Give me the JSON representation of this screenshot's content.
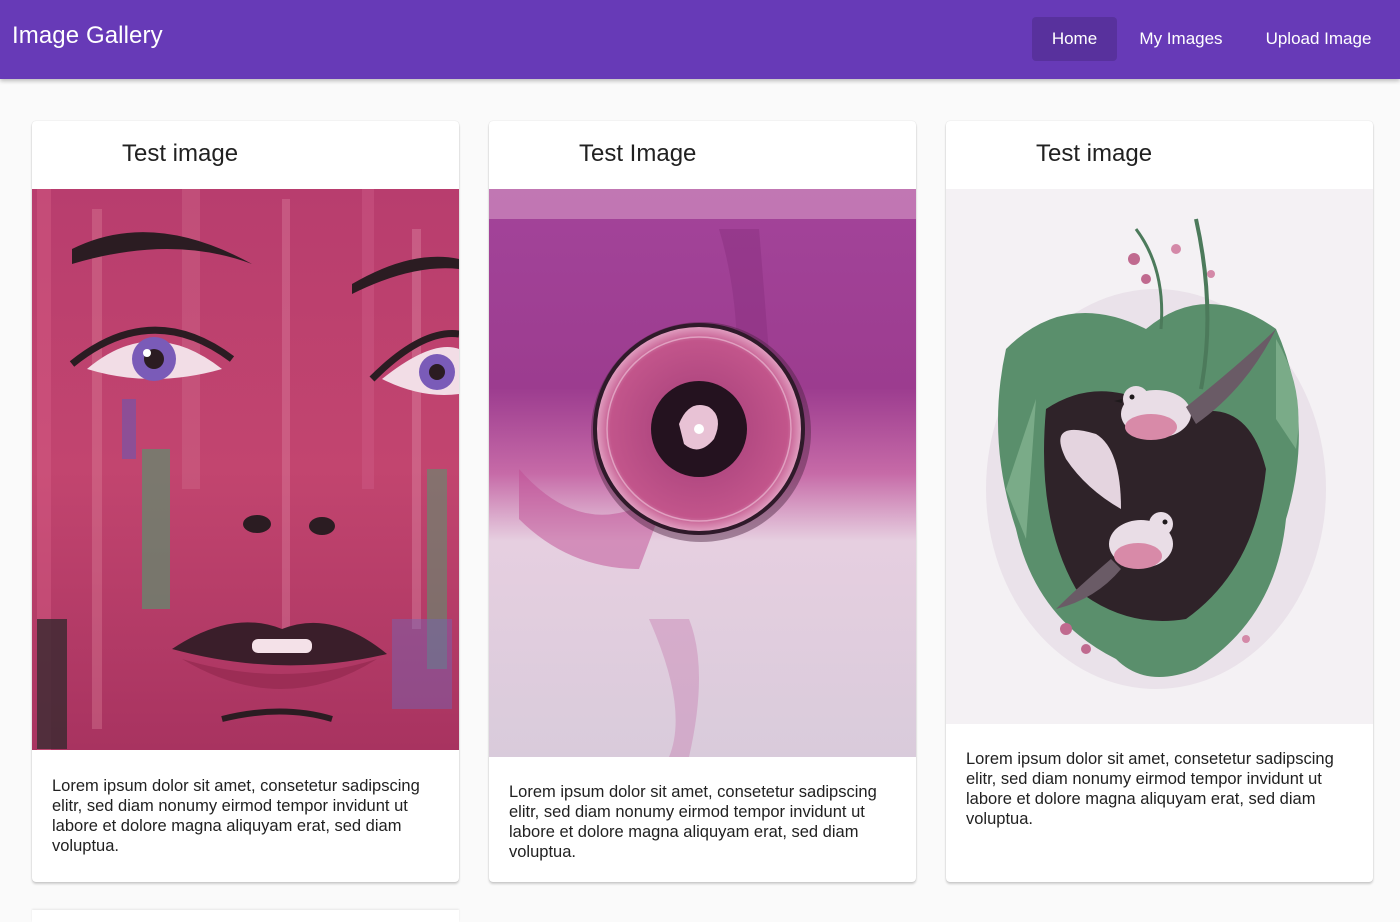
{
  "app": {
    "title": "Image Gallery"
  },
  "nav": {
    "home": "Home",
    "my_images": "My Images",
    "upload": "Upload Image",
    "active": "Home"
  },
  "colors": {
    "toolbar": "#673ab7",
    "background": "#fafafa",
    "card": "#ffffff",
    "text": "#212121"
  },
  "cards": [
    {
      "title": "Test image",
      "image_alt": "Painted woman's face in pink, purple and green",
      "text": "Lorem ipsum dolor sit amet, consetetur sadipscing elitr, sed diam nonumy eirmod tempor invidunt ut labore et dolore magna aliquyam erat, sed diam voluptua."
    },
    {
      "title": "Test Image",
      "image_alt": "Vinyl record disc on magenta watercolor background",
      "text": "Lorem ipsum dolor sit amet, consetetur sadipscing elitr, sed diam nonumy eirmod tempor invidunt ut labore et dolore magna aliquyam erat, sed diam voluptua."
    },
    {
      "title": "Test image",
      "image_alt": "Two birds among green foliage and pink flowers",
      "text": "Lorem ipsum dolor sit amet, consetetur sadipscing elitr, sed diam nonumy eirmod tempor invidunt ut labore et dolore magna aliquyam erat, sed diam voluptua."
    }
  ]
}
